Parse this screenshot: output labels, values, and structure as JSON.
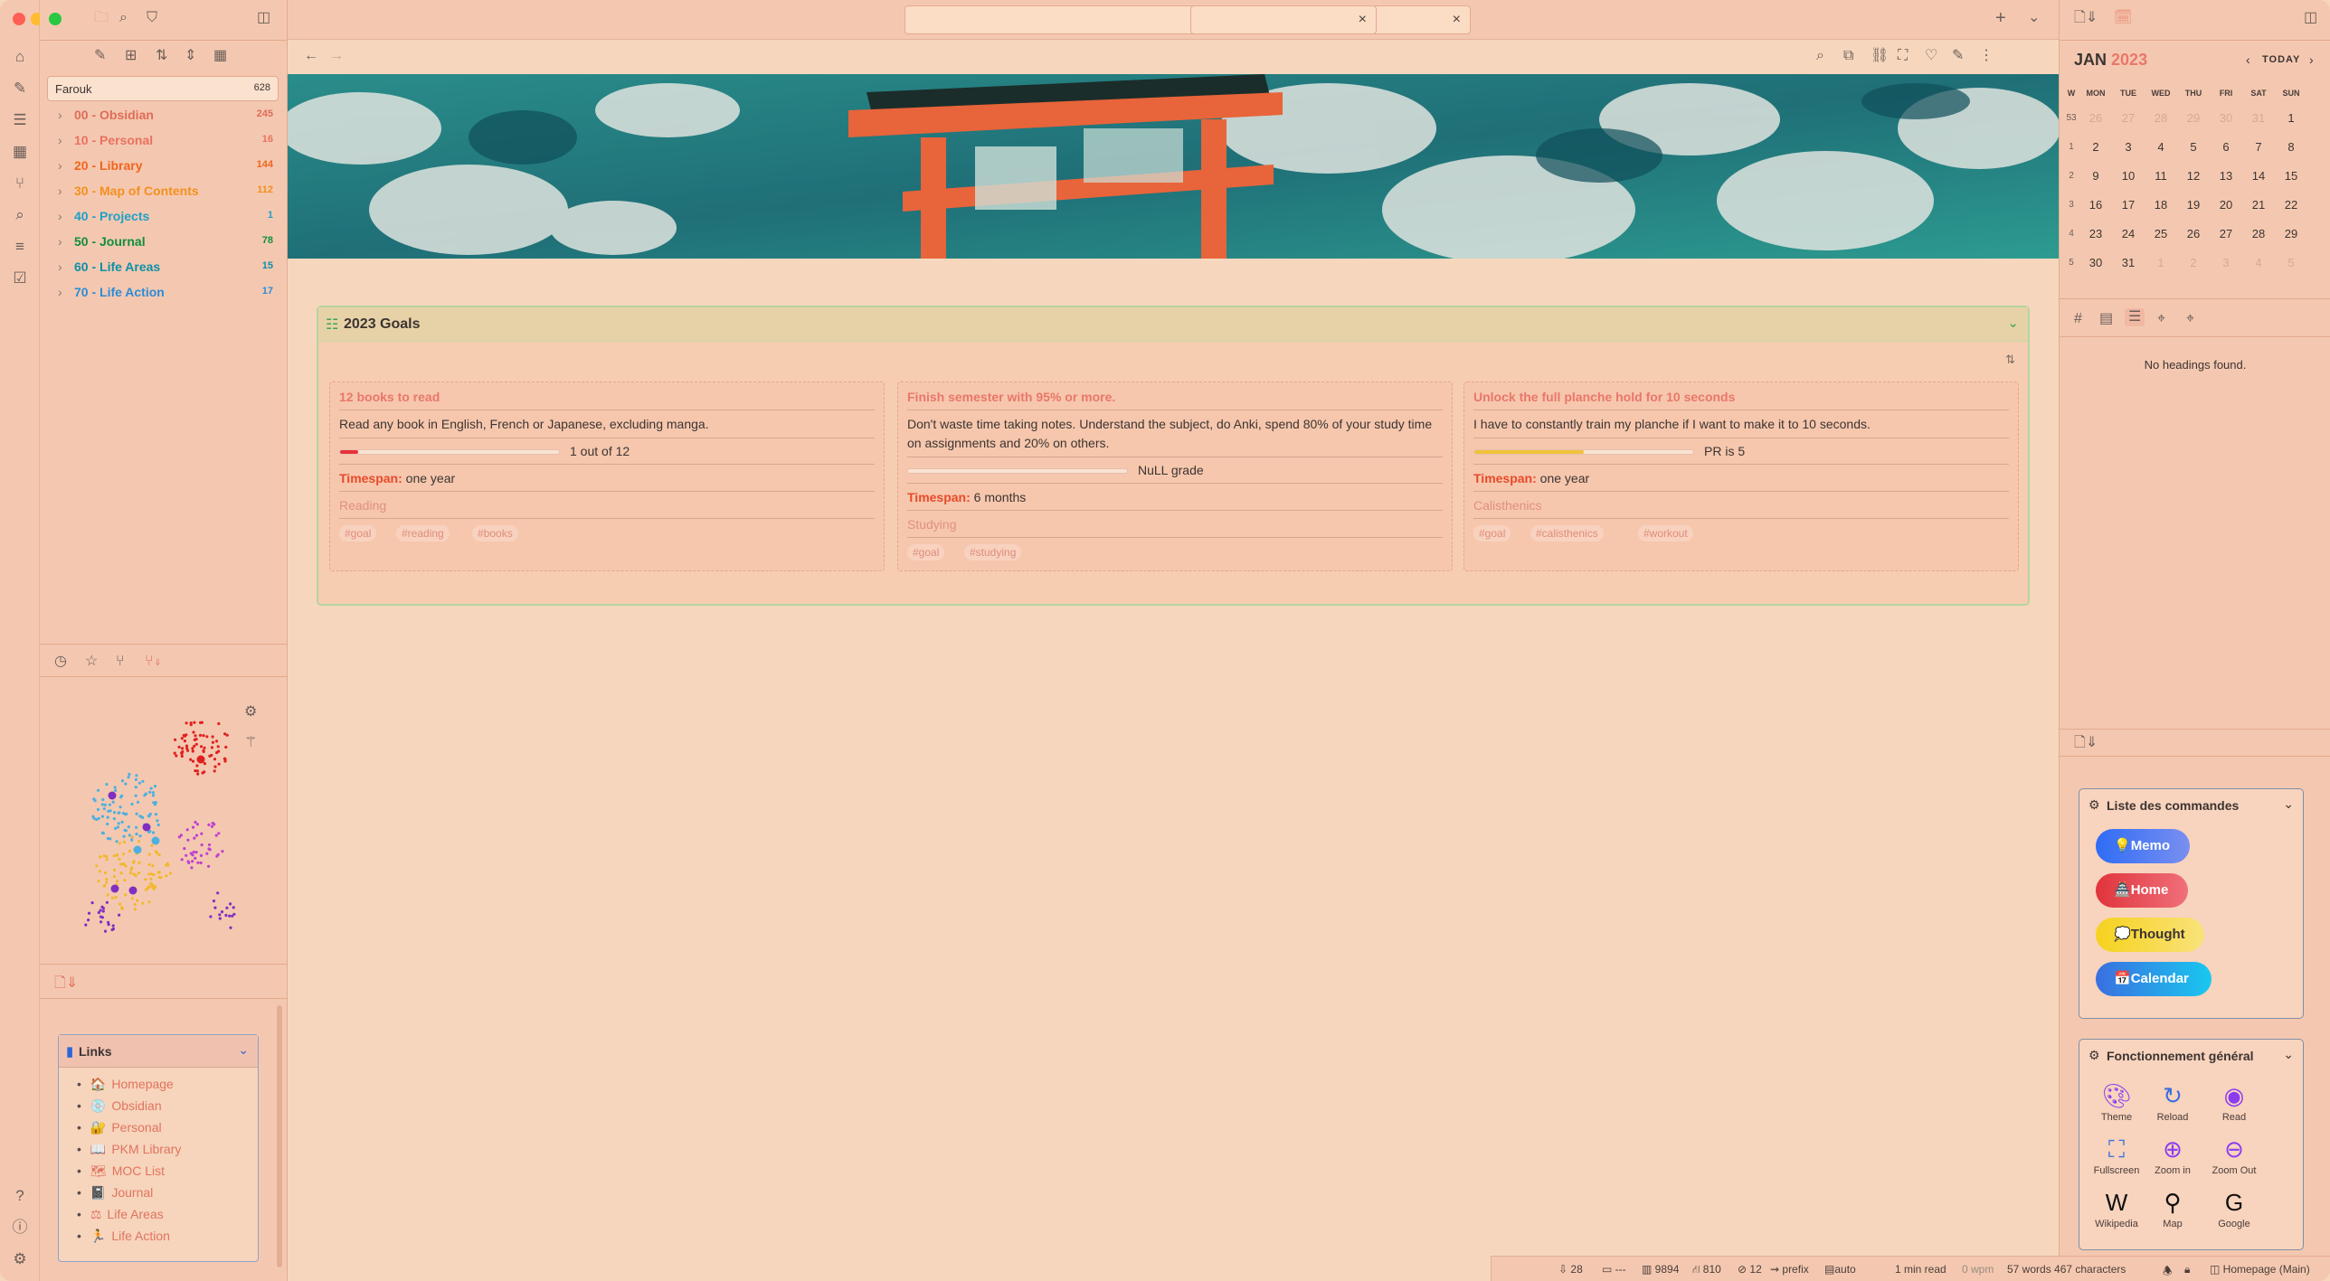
{
  "tabs": [
    {
      "label": ""
    },
    {
      "label": ""
    }
  ],
  "vault": {
    "name": "Farouk",
    "count": "628"
  },
  "folders": [
    {
      "name": "00 - Obsidian",
      "count": "245",
      "color": "#e06c5a"
    },
    {
      "name": "10 - Personal",
      "count": "16",
      "color": "#e8725f"
    },
    {
      "name": "20 - Library",
      "count": "144",
      "color": "#f0651f"
    },
    {
      "name": "30 - Map of Contents",
      "count": "112",
      "color": "#f39020"
    },
    {
      "name": "40 - Projects",
      "count": "1",
      "color": "#1fa0c8"
    },
    {
      "name": "50 - Journal",
      "count": "78",
      "color": "#0f8f3c"
    },
    {
      "name": "60 - Life Areas",
      "count": "15",
      "color": "#0f8fa8"
    },
    {
      "name": "70 - Life Action",
      "count": "17",
      "color": "#2c8cd8"
    }
  ],
  "links": {
    "title": "Links",
    "items": [
      {
        "emoji": "🏠",
        "label": "Homepage"
      },
      {
        "emoji": "💿",
        "label": "Obsidian"
      },
      {
        "emoji": "🔐",
        "label": "Personal"
      },
      {
        "emoji": "📖",
        "label": "PKM Library"
      },
      {
        "emoji": "🗺",
        "label": "MOC List"
      },
      {
        "emoji": "📓",
        "label": "Journal"
      },
      {
        "emoji": "⚖",
        "label": "Life Areas"
      },
      {
        "emoji": "🏃",
        "label": "Life Action"
      }
    ]
  },
  "goals": {
    "title": "2023 Goals",
    "cards": [
      {
        "title": "12 books to read",
        "desc": "Read any book in English, French or Japanese, excluding manga.",
        "progress_text": "1 out of 12",
        "progress": 0.083,
        "progress_color": "#e8323a",
        "timespan_label": "Timespan:",
        "timespan": "one year",
        "category": "Reading",
        "tags": [
          "#goal",
          "#reading",
          "#books"
        ]
      },
      {
        "title": "Finish semester with 95% or more.",
        "desc": "Don't waste time taking notes. Understand the subject, do Anki, spend 80% of your study time on assignments and 20% on others.",
        "progress_text": "NuLL grade",
        "progress": 0,
        "progress_color": "#e8323a",
        "timespan_label": "Timespan:",
        "timespan": "6 months",
        "category": "Studying",
        "tags": [
          "#goal",
          "#studying"
        ]
      },
      {
        "title": "Unlock the full planche hold for 10 seconds",
        "desc": "I have to constantly train my planche if I want to make it to 10 seconds.",
        "progress_text": "PR is 5",
        "progress": 0.5,
        "progress_color": "#f2c33a",
        "timespan_label": "Timespan:",
        "timespan": "one year",
        "category": "Calisthenics",
        "tags": [
          "#goal",
          "#calisthenics",
          "#workout"
        ]
      }
    ]
  },
  "calendar": {
    "month": "JAN",
    "year": "2023",
    "today": "TODAY",
    "weekdays": [
      "W",
      "MON",
      "TUE",
      "WED",
      "THU",
      "FRI",
      "SAT",
      "SUN"
    ],
    "weeks": [
      [
        "53",
        "26",
        "27",
        "28",
        "29",
        "30",
        "31",
        "1"
      ],
      [
        "1",
        "2",
        "3",
        "4",
        "5",
        "6",
        "7",
        "8"
      ],
      [
        "2",
        "9",
        "10",
        "11",
        "12",
        "13",
        "14",
        "15"
      ],
      [
        "3",
        "16",
        "17",
        "18",
        "19",
        "20",
        "21",
        "22"
      ],
      [
        "4",
        "23",
        "24",
        "25",
        "26",
        "27",
        "28",
        "29"
      ],
      [
        "5",
        "30",
        "31",
        "1",
        "2",
        "3",
        "4",
        "5"
      ]
    ]
  },
  "outline": {
    "empty": "No headings found."
  },
  "commands": {
    "title": "Liste des commandes",
    "buttons": [
      {
        "label": "Memo",
        "emoji": "💡"
      },
      {
        "label": "Home",
        "emoji": "🏯"
      },
      {
        "label": "Thought",
        "emoji": "💭"
      },
      {
        "label": "Calendar",
        "emoji": "📅"
      }
    ]
  },
  "general": {
    "title": "Fonctionnement général",
    "items": [
      {
        "label": "Theme",
        "icon": "palette-icon"
      },
      {
        "label": "Reload",
        "icon": "reload-icon"
      },
      {
        "label": "Read",
        "icon": "eye-icon"
      },
      {
        "label": "Fullscreen",
        "icon": "fullscreen-icon"
      },
      {
        "label": "Zoom in",
        "icon": "zoom-in-icon"
      },
      {
        "label": "Zoom Out",
        "icon": "zoom-out-icon"
      },
      {
        "label": "Wikipedia",
        "icon": "wikipedia-icon"
      },
      {
        "label": "Map",
        "icon": "map-pin-icon"
      },
      {
        "label": "Google",
        "icon": "google-icon"
      }
    ]
  },
  "status": {
    "backlinks": "28",
    "dashes": "---",
    "chars": "9894",
    "words": "810",
    "links": "12",
    "prefix": "prefix",
    "auto": "auto",
    "read": "1 min read",
    "wpm": "0 wpm",
    "count": "57 words 467 characters",
    "branch": "Homepage (Main)"
  },
  "colors": {
    "background": "#f6d7bd",
    "sidebar": "#f4c8b0",
    "accent": "#e9776a"
  }
}
